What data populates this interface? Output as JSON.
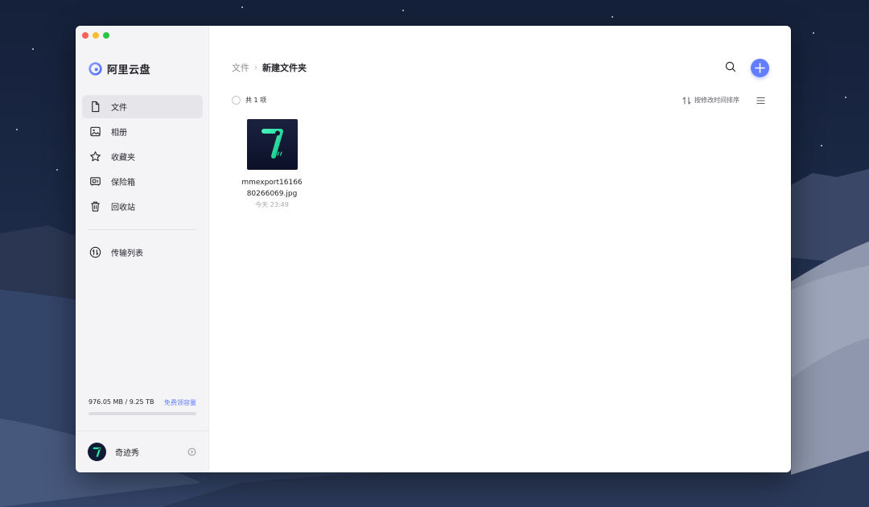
{
  "app": {
    "name": "阿里云盘"
  },
  "sidebar": {
    "nav_items": [
      {
        "label": "文件",
        "icon": "file-icon",
        "active": true
      },
      {
        "label": "相册",
        "icon": "photo-album-icon",
        "active": false
      },
      {
        "label": "收藏夹",
        "icon": "star-icon",
        "active": false
      },
      {
        "label": "保险箱",
        "icon": "safe-box-icon",
        "active": false
      },
      {
        "label": "回收站",
        "icon": "trash-icon",
        "active": false
      }
    ],
    "transfer": {
      "label": "传输列表",
      "icon": "transfer-icon"
    },
    "storage": {
      "usage": "976.05 MB / 9.25 TB",
      "free_link": "免费领容量",
      "used_fraction": 0.0001
    },
    "user": {
      "name": "奇迹秀"
    }
  },
  "main": {
    "breadcrumb": {
      "parent": "文件",
      "separator": "›",
      "current": "新建文件夹"
    },
    "toolbar": {
      "count_text": "共 1 项",
      "sort_label": "按修改时间排序"
    },
    "files": [
      {
        "name_line1": "mmexport16166",
        "name_line2": "80266069.jpg",
        "time": "今天 23:49"
      }
    ]
  },
  "colors": {
    "accent": "#637dff",
    "sidebar_bg": "#f4f4f6",
    "logo_green": "#27e6a0"
  }
}
